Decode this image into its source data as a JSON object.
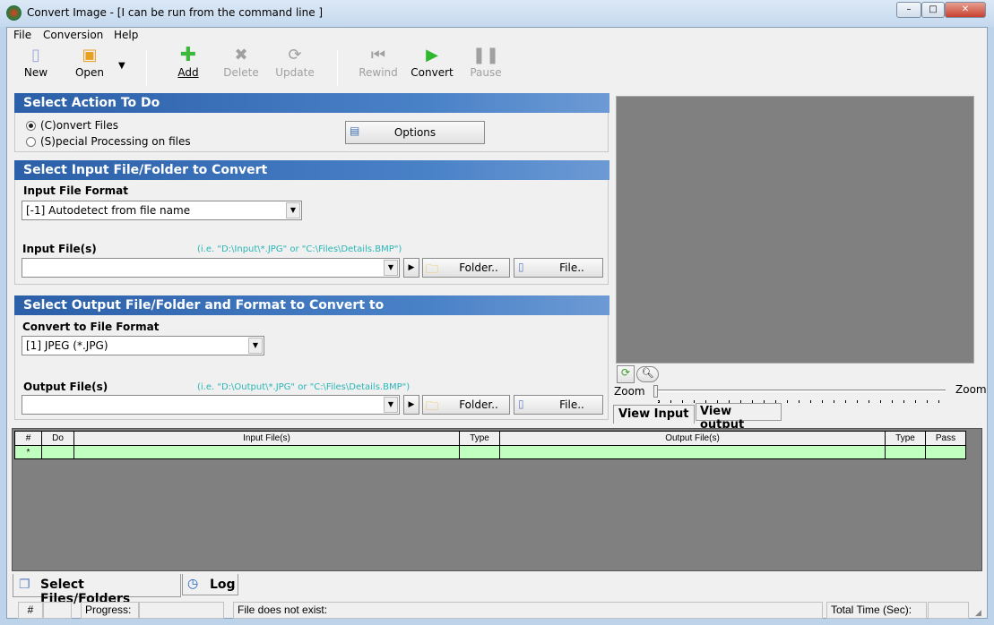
{
  "window": {
    "title": "Convert Image - [I can be run from the command line ]",
    "minimize": "–",
    "maximize": "□",
    "close": "✕"
  },
  "menu": [
    "File",
    "Conversion",
    "Help"
  ],
  "toolbar": {
    "new": "New",
    "open": "Open",
    "add": "Add",
    "delete": "Delete",
    "update": "Update",
    "rewind": "Rewind",
    "convert": "Convert",
    "pause": "Pause"
  },
  "action": {
    "header": "Select Action To Do",
    "convert_files": "(C)onvert Files",
    "special": "(S)pecial Processing on files",
    "options": "Options",
    "selected": "convert_files"
  },
  "input": {
    "header": "Select Input File/Folder to Convert",
    "format_label": "Input File Format",
    "format_value": "[-1] Autodetect from file name",
    "files_label": "Input File(s)",
    "hint": "(i.e. \"D:\\Input\\*.JPG\"  or \"C:\\Files\\Details.BMP\")",
    "files_value": "",
    "folder": "Folder..",
    "file": "File.."
  },
  "output": {
    "header": "Select Output File/Folder and Format to Convert to",
    "format_label": "Convert to File Format",
    "format_value": "[1] JPEG (*.JPG)",
    "files_label": "Output File(s)",
    "hint": "(i.e. \"D:\\Output\\*.JPG\"  or \"C:\\Files\\Details.BMP\")",
    "files_value": "",
    "folder": "Folder..",
    "file": "File.."
  },
  "viewer": {
    "zoom_left": "Zoom",
    "zoom_right": "Zoom",
    "tab_input": "View Input",
    "tab_output": "View output",
    "zoom_level": 0
  },
  "grid": {
    "columns": [
      "#",
      "Do",
      "Input File(s)",
      "Type",
      "Output File(s)",
      "Type",
      "Pass"
    ],
    "rows": [
      [
        "*",
        "",
        "",
        "",
        "",
        "",
        ""
      ]
    ]
  },
  "tabs": {
    "select": "Select Files/Folders",
    "log": "Log"
  },
  "status": {
    "hash": "#",
    "progress": "Progress:",
    "message": "File does not exist:",
    "total_time": "Total Time (Sec):"
  }
}
